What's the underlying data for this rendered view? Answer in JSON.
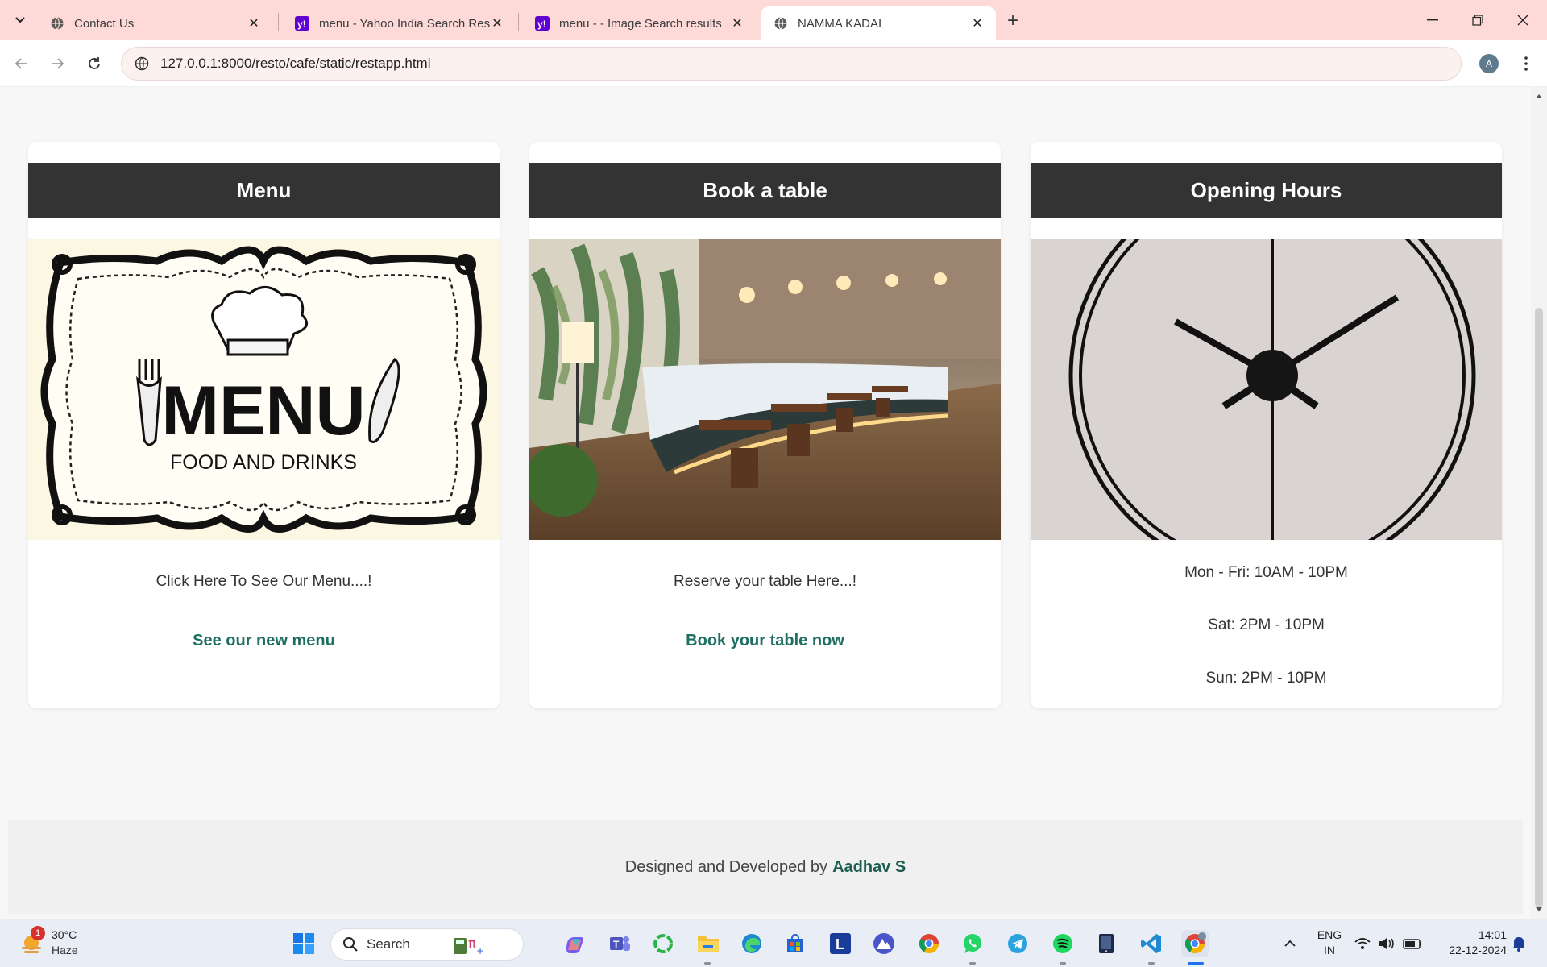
{
  "browser": {
    "tabs": [
      {
        "title": "Contact Us",
        "favicon": "globe-icon",
        "active": false
      },
      {
        "title": "menu - Yahoo India Search Results",
        "favicon": "yahoo-icon",
        "active": false
      },
      {
        "title": "menu - - Image Search results",
        "favicon": "yahoo-icon",
        "active": false
      },
      {
        "title": "NAMMA KADAI",
        "favicon": "globe-icon",
        "active": true
      }
    ],
    "url": "127.0.0.1:8000/resto/cafe/static/restapp.html",
    "profile_initial": "A"
  },
  "cards": [
    {
      "heading": "Menu",
      "text": "Click Here To See Our Menu....!",
      "link": "See our new menu",
      "image": {
        "heading_word": "MENU",
        "sub_text": "FOOD AND DRINKS"
      }
    },
    {
      "heading": "Book a table",
      "text": "Reserve your table Here...!",
      "link": "Book your table now"
    },
    {
      "heading": "Opening Hours",
      "hours": [
        "Mon - Fri: 10AM - 10PM",
        "Sat: 2PM - 10PM",
        "Sun: 2PM - 10PM"
      ]
    }
  ],
  "footer": {
    "prefix": "Designed and Developed by",
    "author": "Aadhav S"
  },
  "taskbar": {
    "weather": {
      "temp": "30°C",
      "condition": "Haze",
      "badge": "1"
    },
    "search_label": "Search",
    "language": {
      "line1": "ENG",
      "line2": "IN"
    },
    "time": "14:01",
    "date": "22-12-2024"
  },
  "colors": {
    "accent_link": "#1e6f62",
    "header_bar": "#333333",
    "tabbar": "#fdd9d7"
  }
}
